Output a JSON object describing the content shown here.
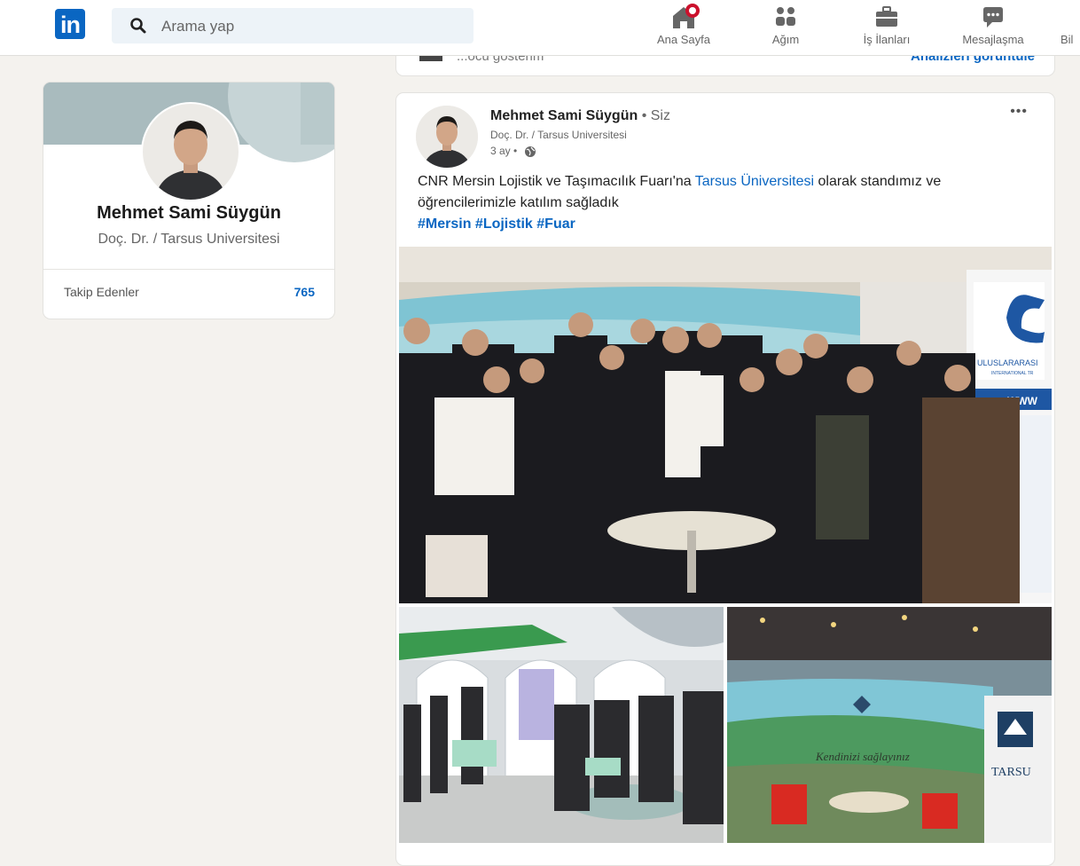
{
  "nav": {
    "logo_text": "in",
    "search_placeholder": "Arama yap",
    "items": [
      {
        "label": "Ana Sayfa",
        "icon": "home-icon"
      },
      {
        "label": "Ağım",
        "icon": "network-icon"
      },
      {
        "label": "İş İlanları",
        "icon": "jobs-icon"
      },
      {
        "label": "Mesajlaşma",
        "icon": "messaging-icon"
      },
      {
        "label": "Bil",
        "icon": "notifications-icon"
      }
    ]
  },
  "profile": {
    "name": "Mehmet Sami Süygün",
    "headline": "Doç. Dr. / Tarsus Universitesi",
    "followers_label": "Takip Edenler",
    "followers_count": "765"
  },
  "previous_card": {
    "text": "...ocü gösterim",
    "link": "Analizleri görüntüle"
  },
  "post": {
    "author": "Mehmet Sami Süygün",
    "author_suffix": "• Siz",
    "author_headline": "Doç. Dr. / Tarsus Universitesi",
    "time": "3 ay •",
    "text_part1": "CNR Mersin Lojistik ve Taşımacılık Fuarı'na ",
    "text_mention": "Tarsus Üniversitesi",
    "text_part2": " olarak standımız ve öğrencilerimizle katılım sağladık",
    "hashtags": "#Mersin #Lojistik #Fuar",
    "more": "•••",
    "image_captions": {
      "booth_sign": "ULUSLARARASI",
      "booth_sign_sub": "INTERNATIONAL TR",
      "booth_www": "WWW",
      "wall_text": "Kendinizi sağlayınız",
      "banner_text": "TARSU"
    }
  },
  "colors": {
    "brand": "#0a66c2",
    "notification": "#cb112d",
    "background": "#f4f2ee"
  }
}
